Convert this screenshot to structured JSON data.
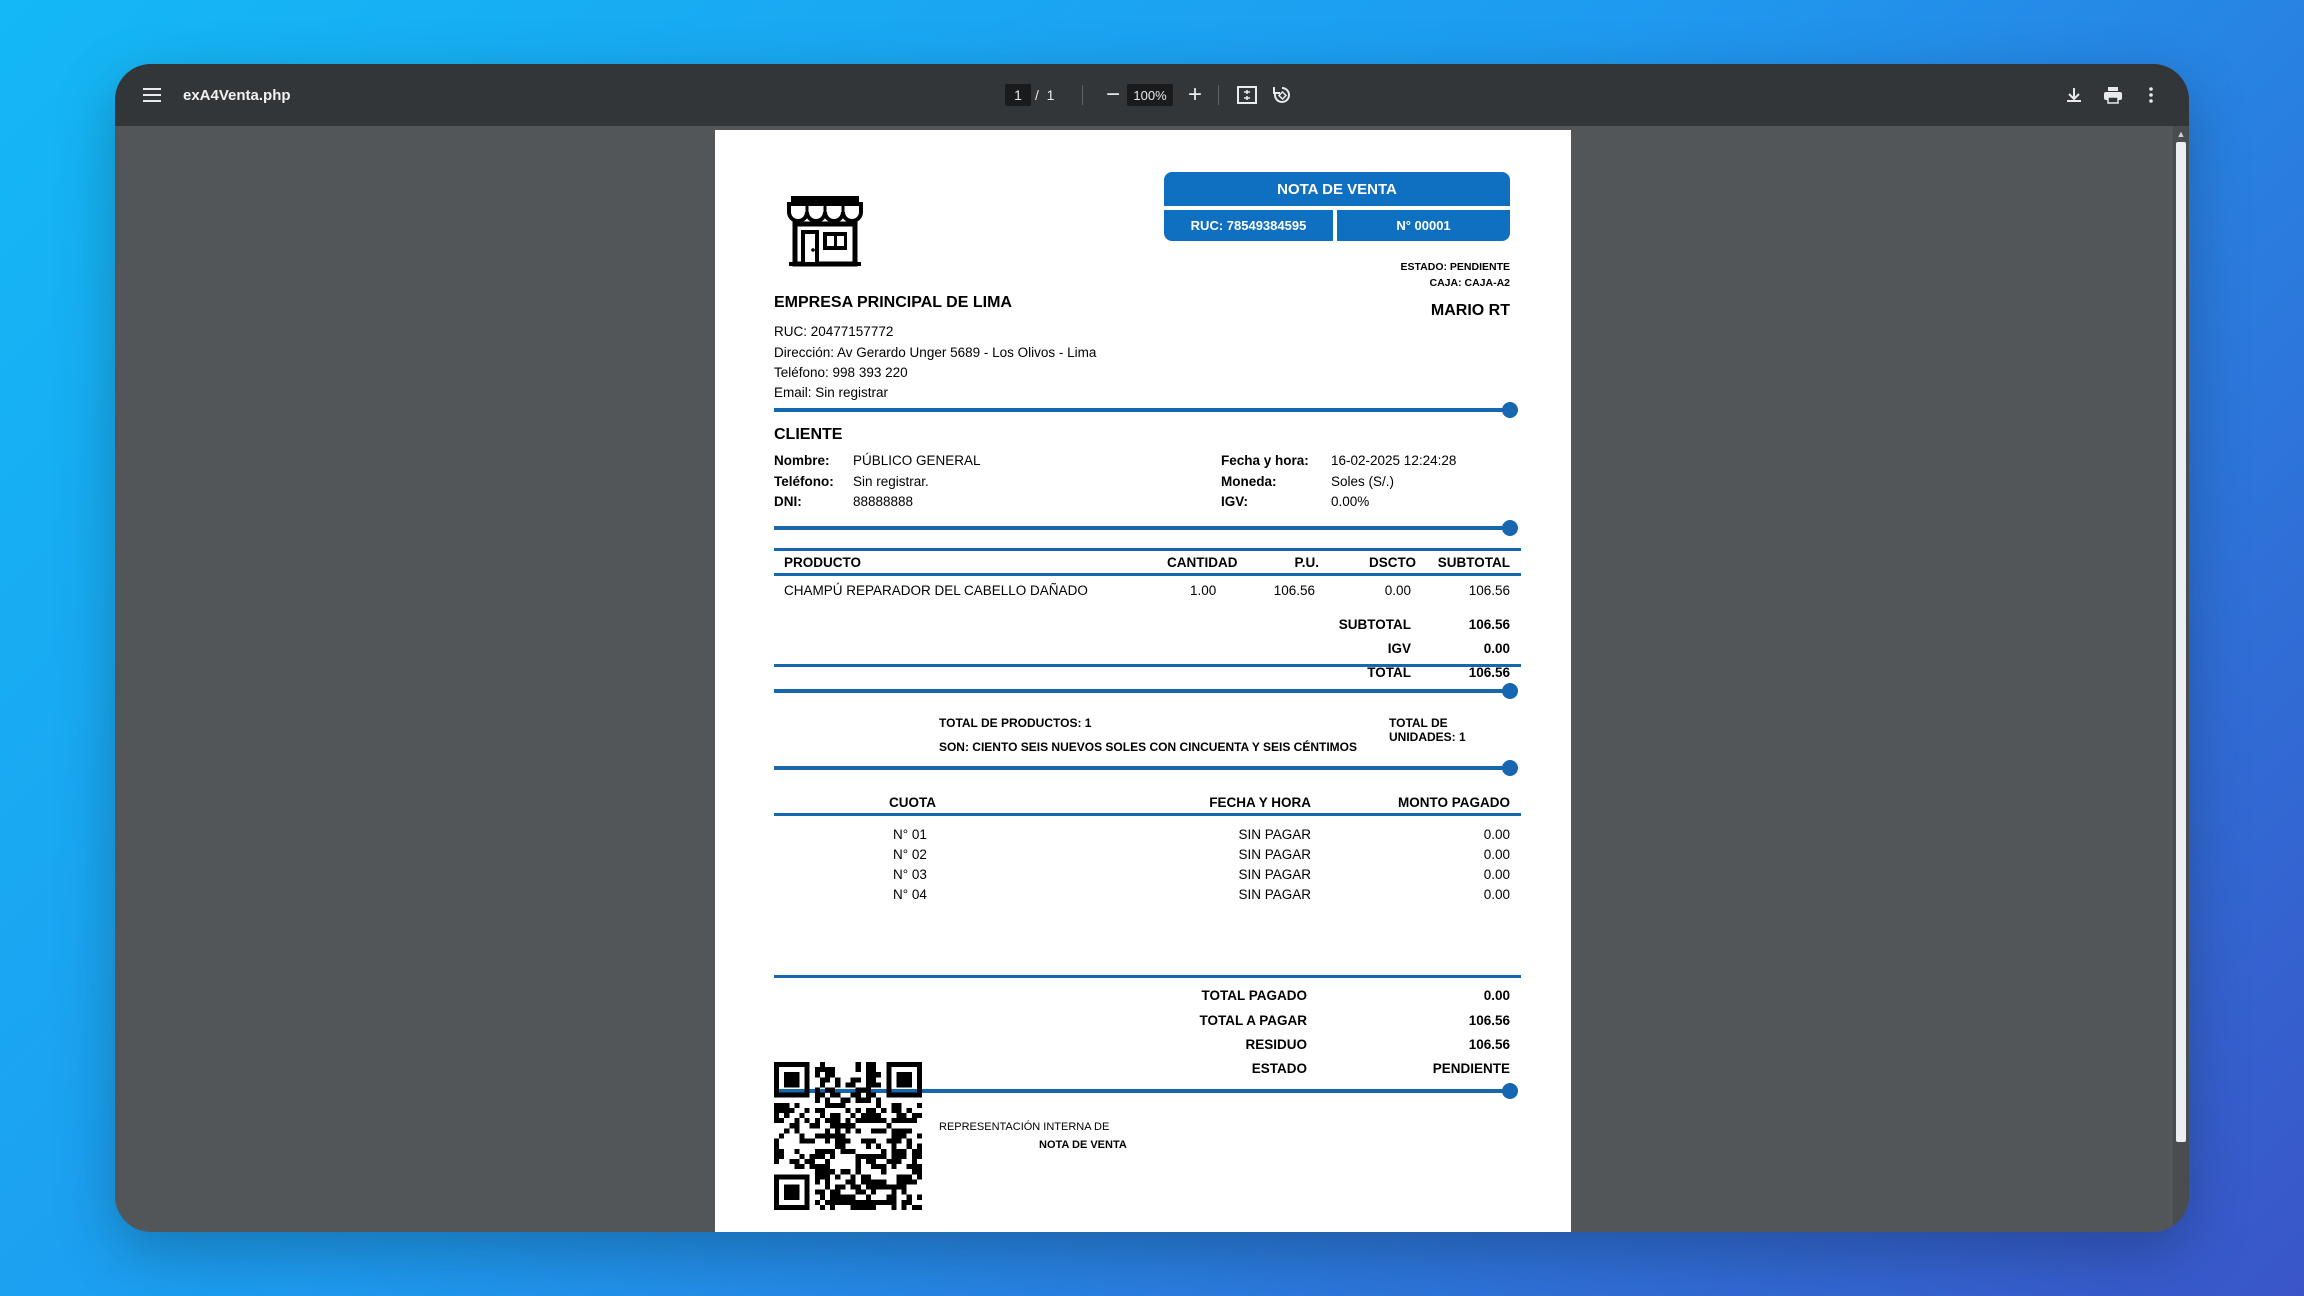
{
  "viewer": {
    "file_name": "exA4Venta.php",
    "page_current": "1",
    "page_separator": "/",
    "page_total": "1",
    "zoom_minus": "−",
    "zoom": "100%",
    "zoom_plus": "+"
  },
  "document": {
    "header": {
      "title": "NOTA DE VENTA",
      "ruc": "RUC: 78549384595",
      "number": "N° 00001",
      "estado": "ESTADO: PENDIENTE",
      "caja": "CAJA: CAJA-A2",
      "vendedor": "MARIO RT"
    },
    "company": {
      "name": "EMPRESA PRINCIPAL DE LIMA",
      "ruc": "RUC: 20477157772",
      "address": "Dirección: Av Gerardo Unger 5689 - Los Olivos - Lima",
      "phone": "Teléfono: 998 393 220",
      "email": "Email: Sin registrar"
    },
    "client": {
      "heading": "CLIENTE",
      "name_label": "Nombre:",
      "name": "PÚBLICO GENERAL",
      "phone_label": "Teléfono:",
      "phone": "Sin registrar.",
      "dni_label": "DNI:",
      "dni": "88888888",
      "date_label": "Fecha y hora:",
      "date": "16-02-2025 12:24:28",
      "currency_label": "Moneda:",
      "currency": "Soles (S/.)",
      "igv_label": "IGV:",
      "igv": "0.00%"
    },
    "products": {
      "headers": [
        "PRODUCTO",
        "CANTIDAD",
        "P.U.",
        "DSCTO",
        "SUBTOTAL"
      ],
      "rows": [
        [
          "CHAMPÚ REPARADOR DEL CABELLO DAÑADO",
          "1.00",
          "106.56",
          "0.00",
          "106.56"
        ]
      ]
    },
    "totals": {
      "subtotal_label": "SUBTOTAL",
      "subtotal": "106.56",
      "igv_label": "IGV",
      "igv": "0.00",
      "total_label": "TOTAL",
      "total": "106.56"
    },
    "summary": {
      "total_products": "TOTAL DE PRODUCTOS: 1",
      "total_units": "TOTAL DE UNIDADES: 1",
      "amount_words": "SON: CIENTO SEIS NUEVOS SOLES CON CINCUENTA Y SEIS CÉNTIMOS"
    },
    "installments": {
      "headers": [
        "CUOTA",
        "FECHA Y HORA",
        "MONTO PAGADO"
      ],
      "rows": [
        [
          "N° 01",
          "SIN PAGAR",
          "0.00"
        ],
        [
          "N° 02",
          "SIN PAGAR",
          "0.00"
        ],
        [
          "N° 03",
          "SIN PAGAR",
          "0.00"
        ],
        [
          "N° 04",
          "SIN PAGAR",
          "0.00"
        ]
      ]
    },
    "payment": {
      "paid_label": "TOTAL PAGADO",
      "paid": "0.00",
      "to_pay_label": "TOTAL A PAGAR",
      "to_pay": "106.56",
      "residue_label": "RESIDUO",
      "residue": "106.56",
      "status_label": "ESTADO",
      "status": "PENDIENTE"
    },
    "footer": {
      "line1": "REPRESENTACIÓN INTERNA DE",
      "line2": "NOTA DE VENTA"
    }
  },
  "colors": {
    "accent": "#0f6fc1",
    "toolbar": "#323639",
    "viewer_bg": "#525659"
  }
}
